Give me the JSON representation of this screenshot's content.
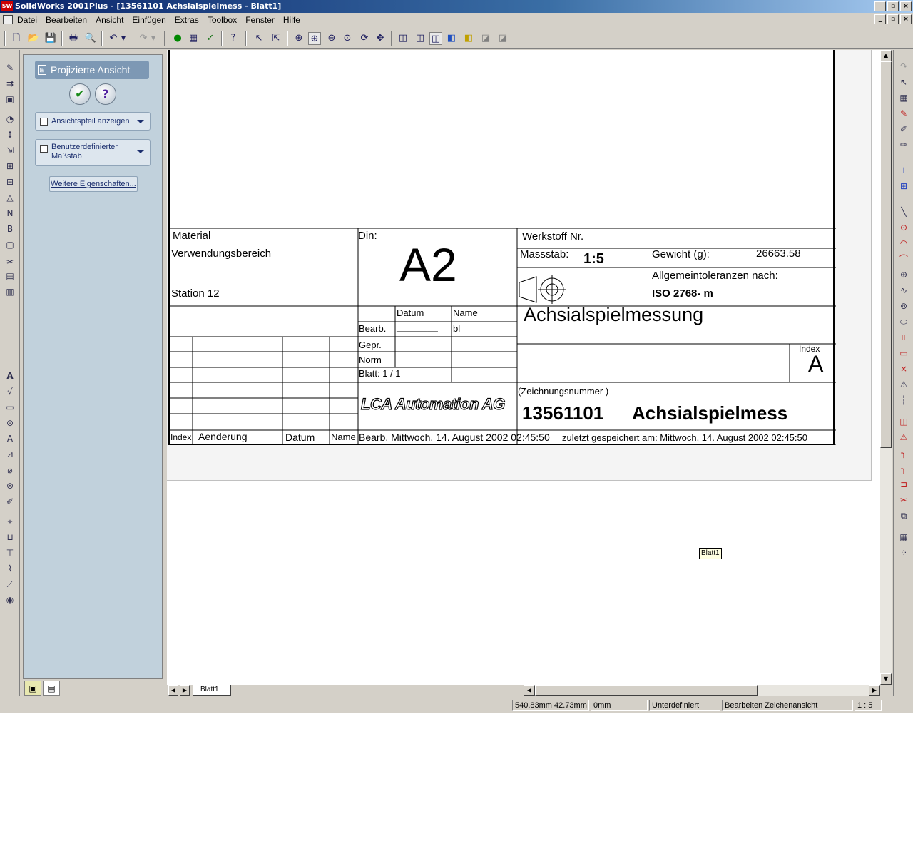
{
  "window": {
    "title": "SolidWorks 2001Plus - [13561101    Achsialspielmess - Blatt1]",
    "app_icon_text": "SW"
  },
  "menu": [
    "Datei",
    "Bearbeiten",
    "Ansicht",
    "Einfügen",
    "Extras",
    "Toolbox",
    "Fenster",
    "Hilfe"
  ],
  "property_manager": {
    "title": "Projizierte Ansicht",
    "ok_symbol": "✔",
    "help_symbol": "?",
    "option1_label": "Ansichtspfeil anzeigen",
    "option2_label_line1": "Benutzerdefinierter",
    "option2_label_line2": "Maßstab",
    "more_button": "Weitere Eigenschaften..."
  },
  "title_block": {
    "material_label": "Material",
    "din_label": "Din:",
    "werkstoff_label": "Werkstoff Nr.",
    "verwendung_label": "Verwendungsbereich",
    "format": "A2",
    "massstab_label": "Massstab:",
    "massstab_value": "1:5",
    "gewicht_label": "Gewicht (g):",
    "gewicht_value": "26663.58",
    "toleranz_label": "Allgemeintoleranzen nach:",
    "toleranz_value": "ISO 2768- m",
    "station": "Station 12",
    "datum_header": "Datum",
    "name_header": "Name",
    "bearb_label": "Bearb.",
    "bearb_datum": "________",
    "bearb_name": "bl",
    "gepr_label": "Gepr.",
    "norm_label": "Norm",
    "blatt_label": "Blatt: 1 / 1",
    "drawing_title": "Achsialspielmessung",
    "index_label": "Index",
    "index_value": "A",
    "company_logo": "LCA Automation AG",
    "zeichnungsnr_label": "(Zeichnungsnummer )",
    "zeichnungsnr_value": "13561101",
    "zeichnung_name": "Achsialspielmess",
    "footer_index": "Index",
    "footer_aenderung": "Aenderung",
    "footer_datum": "Datum",
    "footer_name": "Name",
    "footer_bearb": "Bearb.  Mittwoch, 14. August 2002 02:45:50",
    "footer_gespeichert": "zuletzt gespeichert am:  Mittwoch, 14. August 2002 02:45:50"
  },
  "sheet_label": "Blatt1",
  "sheet_tab": "Blatt1",
  "status": {
    "coords": "540.83mm 42.73mm",
    "z": "0mm",
    "state": "Unterdefiniert",
    "mode": "Bearbeiten Zeichenansicht",
    "scale": "1 : 5"
  },
  "icons": {
    "toolbar": [
      "new-icon",
      "open-icon",
      "save-icon",
      "print-icon",
      "print-preview-icon",
      "undo-icon",
      "redo-icon",
      "traffic-light-icon",
      "grid-icon",
      "check-icon",
      "whats-this-icon",
      "select-icon",
      "select-filter-icon",
      "zoom-fit-icon",
      "zoom-area-icon",
      "zoom-in-out-icon",
      "zoom-selection-icon",
      "rotate-icon",
      "pan-icon",
      "wireframe-icon",
      "hidden-lines-icon",
      "hidden-removed-icon",
      "shaded-icon",
      "shaded-edges-icon",
      "perspective-icon",
      "section-icon"
    ]
  }
}
